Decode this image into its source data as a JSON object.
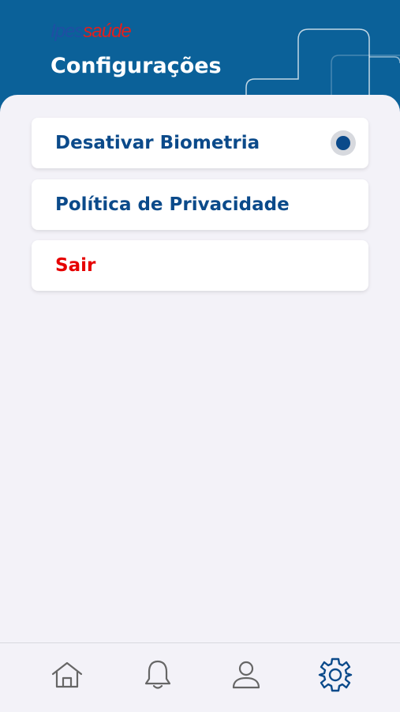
{
  "header": {
    "logo_part1": "Ipes",
    "logo_part2": "saúde",
    "title": "Configurações"
  },
  "settings": {
    "items": [
      {
        "label": "Desativar Biometria",
        "has_toggle": true,
        "toggle_on": true
      },
      {
        "label": "Política de Privacidade"
      },
      {
        "label": "Sair",
        "danger": true
      }
    ]
  },
  "tabbar": {
    "tabs": [
      {
        "icon": "home-icon",
        "active": false
      },
      {
        "icon": "bell-icon",
        "active": false
      },
      {
        "icon": "user-icon",
        "active": false
      },
      {
        "icon": "gear-icon",
        "active": true
      }
    ]
  },
  "colors": {
    "header_bg": "#0b6199",
    "primary_text": "#0b4a8a",
    "danger": "#e60000",
    "background": "#f3f2f8",
    "tab_inactive": "#666666",
    "tab_active": "#0b4a8a"
  }
}
